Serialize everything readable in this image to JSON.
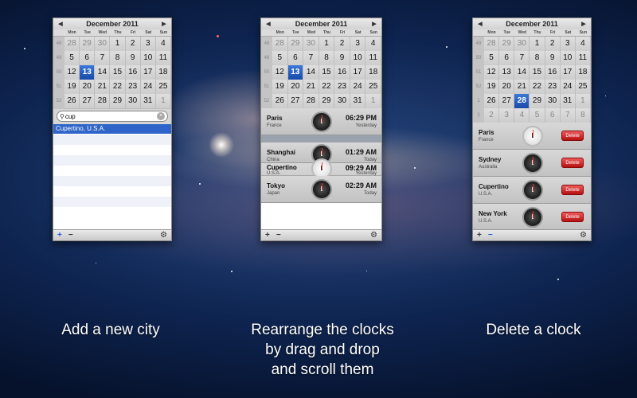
{
  "month_title": "December 2011",
  "weekdays": [
    "Mon",
    "Tue",
    "Wed",
    "Thu",
    "Fri",
    "Sat",
    "Sun"
  ],
  "weeks": [
    {
      "wk": "48",
      "days": [
        "28",
        "29",
        "30",
        "1",
        "2",
        "3",
        "4"
      ]
    },
    {
      "wk": "49",
      "days": [
        "5",
        "6",
        "7",
        "8",
        "9",
        "10",
        "11"
      ]
    },
    {
      "wk": "50",
      "days": [
        "12",
        "13",
        "14",
        "15",
        "16",
        "17",
        "18"
      ]
    },
    {
      "wk": "51",
      "days": [
        "19",
        "20",
        "21",
        "22",
        "23",
        "24",
        "25"
      ]
    },
    {
      "wk": "52",
      "days": [
        "26",
        "27",
        "28",
        "29",
        "30",
        "31",
        "1"
      ]
    }
  ],
  "panel3_weeks": [
    {
      "wk": "49",
      "days": [
        "28",
        "29",
        "30",
        "1",
        "2",
        "3",
        "4"
      ]
    },
    {
      "wk": "50",
      "days": [
        "5",
        "6",
        "7",
        "8",
        "9",
        "10",
        "11"
      ]
    },
    {
      "wk": "51",
      "days": [
        "12",
        "13",
        "14",
        "15",
        "16",
        "17",
        "18"
      ]
    },
    {
      "wk": "52",
      "days": [
        "19",
        "20",
        "21",
        "22",
        "23",
        "24",
        "25"
      ]
    },
    {
      "wk": "1",
      "days": [
        "26",
        "27",
        "28",
        "29",
        "30",
        "31",
        "1"
      ]
    },
    {
      "wk": "2",
      "days": [
        "2",
        "3",
        "4",
        "5",
        "6",
        "7",
        "8"
      ]
    }
  ],
  "search": {
    "value": "cup",
    "result": "Cupertino, U.S.A."
  },
  "panel2_clocks": {
    "paris": {
      "city": "Paris",
      "country": "France",
      "time": "06:29 PM",
      "day": "Yesterday"
    },
    "shanghai": {
      "city": "Shanghai",
      "country": "China",
      "time": "01:29 AM",
      "day": "Today"
    },
    "cupertino": {
      "city": "Cupertino",
      "country": "U.S.A.",
      "time": "09:29 AM",
      "day": "Yesterday"
    },
    "tokyo": {
      "city": "Tokyo",
      "country": "Japan",
      "time": "02:29 AM",
      "day": "Today"
    }
  },
  "panel3_clocks": [
    {
      "city": "Paris",
      "country": "France"
    },
    {
      "city": "Sydney",
      "country": "Australia"
    },
    {
      "city": "Cupertino",
      "country": "U.S.A."
    },
    {
      "city": "New York",
      "country": "U.S.A."
    }
  ],
  "delete_label": "Delete",
  "bar": {
    "add": "+",
    "remove": "−",
    "gear": "⚙"
  },
  "captions": {
    "left": "Add a new city",
    "middle_1": "Rearrange the clocks",
    "middle_2": "by drag and drop",
    "middle_3": "and scroll them",
    "right": "Delete a clock"
  },
  "colors": {
    "selection": "#1a4aa8",
    "delete": "#b61010",
    "add_icon": "#2a5fd0"
  }
}
